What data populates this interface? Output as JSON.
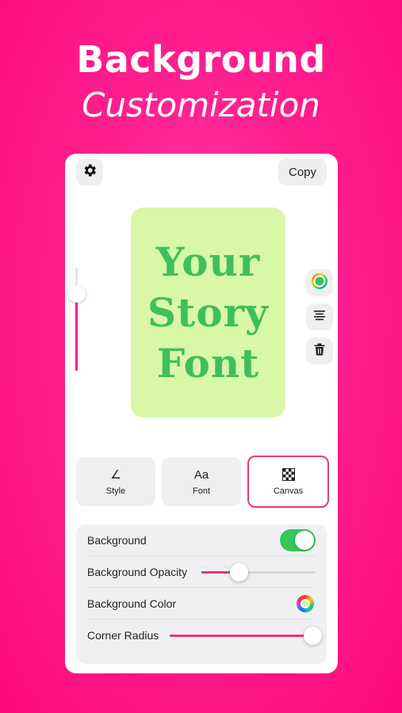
{
  "hero": {
    "title": "Background",
    "subtitle": "Customization"
  },
  "toolbar": {
    "settings_icon": "gear-icon",
    "copy_label": "Copy"
  },
  "preview": {
    "lines": [
      "Your",
      "Story",
      "Font"
    ],
    "background_color": "#d8f8a8",
    "text_color": "#3fbf5c"
  },
  "text_size_slider": {
    "value": 0.25
  },
  "side_tools": [
    "color-wheel-icon",
    "align-center-icon",
    "trash-icon"
  ],
  "tabs": [
    {
      "label": "Style",
      "icon": "pen-icon",
      "glyph": "∠"
    },
    {
      "label": "Font",
      "icon": "font-icon",
      "glyph": "Aa"
    },
    {
      "label": "Canvas",
      "icon": "checkerboard-icon",
      "glyph": ""
    }
  ],
  "active_tab": "Canvas",
  "canvas_settings": {
    "background_label": "Background",
    "background_enabled": true,
    "opacity_label": "Background Opacity",
    "opacity_value": 0.33,
    "color_label": "Background Color",
    "corner_radius_label": "Corner Radius",
    "corner_radius_value": 1.0
  },
  "colors": {
    "accent": "#ff1f8f",
    "toggle_on": "#34c759",
    "active_tab_border": "#e8357e"
  }
}
